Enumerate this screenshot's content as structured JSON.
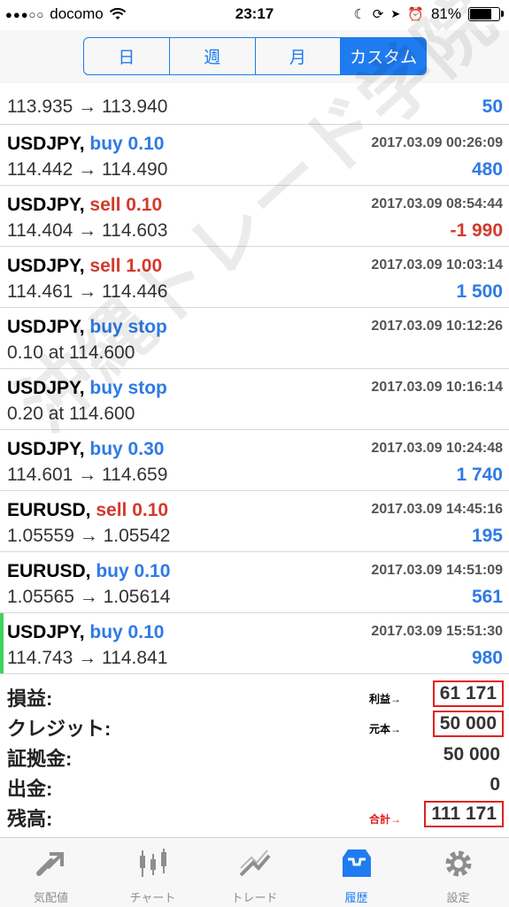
{
  "status": {
    "carrier": "docomo",
    "time": "23:17",
    "battery": "81%",
    "battery_level": 0.81
  },
  "segments": [
    {
      "label": "日",
      "active": false
    },
    {
      "label": "週",
      "active": false
    },
    {
      "label": "月",
      "active": false
    },
    {
      "label": "カスタム",
      "active": true
    }
  ],
  "trades": [
    {
      "symbol": "",
      "type": "",
      "side": "buy",
      "time": "",
      "price": "113.935 → 113.940",
      "profit": "50",
      "sign": "pos",
      "partial": true
    },
    {
      "symbol": "USDJPY,",
      "type": "buy 0.10",
      "side": "buy",
      "time": "2017.03.09 00:26:09",
      "price": "114.442 → 114.490",
      "profit": "480",
      "sign": "pos"
    },
    {
      "symbol": "USDJPY,",
      "type": "sell 0.10",
      "side": "sell",
      "time": "2017.03.09 08:54:44",
      "price": "114.404 → 114.603",
      "profit": "-1 990",
      "sign": "neg"
    },
    {
      "symbol": "USDJPY,",
      "type": "sell 1.00",
      "side": "sell",
      "time": "2017.03.09 10:03:14",
      "price": "114.461 → 114.446",
      "profit": "1 500",
      "sign": "pos"
    },
    {
      "symbol": "USDJPY,",
      "type": "buy stop",
      "side": "buy",
      "time": "2017.03.09 10:12:26",
      "price": "0.10 at 114.600",
      "profit": "",
      "sign": "pos"
    },
    {
      "symbol": "USDJPY,",
      "type": "buy stop",
      "side": "buy",
      "time": "2017.03.09 10:16:14",
      "price": "0.20 at 114.600",
      "profit": "",
      "sign": "pos"
    },
    {
      "symbol": "USDJPY,",
      "type": "buy 0.30",
      "side": "buy",
      "time": "2017.03.09 10:24:48",
      "price": "114.601 → 114.659",
      "profit": "1 740",
      "sign": "pos"
    },
    {
      "symbol": "EURUSD,",
      "type": "sell 0.10",
      "side": "sell",
      "time": "2017.03.09 14:45:16",
      "price": "1.05559 → 1.05542",
      "profit": "195",
      "sign": "pos"
    },
    {
      "symbol": "EURUSD,",
      "type": "buy 0.10",
      "side": "buy",
      "time": "2017.03.09 14:51:09",
      "price": "1.05565 → 1.05614",
      "profit": "561",
      "sign": "pos"
    },
    {
      "symbol": "USDJPY,",
      "type": "buy 0.10",
      "side": "buy",
      "time": "2017.03.09 15:51:30",
      "price": "114.743 → 114.841",
      "profit": "980",
      "sign": "pos",
      "highlight": true
    }
  ],
  "summary": {
    "profit_label": "損益:",
    "profit_value": "61 171",
    "profit_note": "利益→",
    "credit_label": "クレジット:",
    "credit_value": "50 000",
    "credit_note": "元本→",
    "deposit_label": "証拠金:",
    "deposit_value": "50 000",
    "withdrawal_label": "出金:",
    "withdrawal_value": "0",
    "balance_label": "残高:",
    "balance_value": "111 171",
    "balance_note": "合計→"
  },
  "watermark": "沖縄トレード学院",
  "tabs": [
    {
      "label": "気配値",
      "icon": "quotes-icon",
      "active": false
    },
    {
      "label": "チャート",
      "icon": "chart-icon",
      "active": false
    },
    {
      "label": "トレード",
      "icon": "trade-icon",
      "active": false
    },
    {
      "label": "履歴",
      "icon": "history-icon",
      "active": true
    },
    {
      "label": "設定",
      "icon": "settings-icon",
      "active": false
    }
  ]
}
